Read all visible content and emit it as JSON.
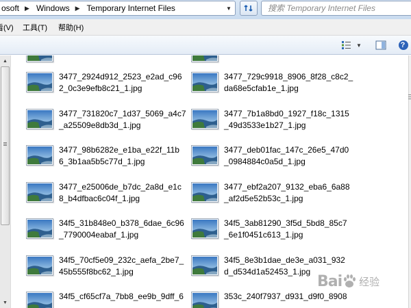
{
  "address": {
    "crumbs": [
      "osoft",
      "Windows",
      "Temporary Internet Files"
    ],
    "separator": "▶",
    "dropdown_icon": "chevron-down-icon"
  },
  "search": {
    "placeholder": "搜索 Temporary Internet Files",
    "icon": "search-icon"
  },
  "refresh": {
    "icon": "refresh-icon"
  },
  "menu": [
    {
      "label": "看(V)"
    },
    {
      "label": "工具(T)"
    },
    {
      "label": "帮助(H)"
    }
  ],
  "toolbar": {
    "view_icon": "view-options-icon",
    "view_dropdown_icon": "chevron-down-icon",
    "preview_pane_icon": "preview-pane-icon",
    "help_icon": "help-icon",
    "help_label": "?"
  },
  "files": [
    {
      "line1": "3477_2924d912_2523_e2ad_c96",
      "line2": "2_0c3e9efb8c21_1.jpg"
    },
    {
      "line1": "3477_729c9918_8906_8f28_c8c2_",
      "line2": "da68e5cfab1e_1.jpg"
    },
    {
      "line1": "3477_731820c7_1d37_5069_a4c7",
      "line2": "_a25509e8db3d_1.jpg"
    },
    {
      "line1": "3477_7b1a8bd0_1927_f18c_1315",
      "line2": "_49d3533e1b27_1.jpg"
    },
    {
      "line1": "3477_98b6282e_e1ba_e22f_11b",
      "line2": "6_3b1aa5b5c77d_1.jpg"
    },
    {
      "line1": "3477_deb01fac_147c_26e5_47d0",
      "line2": "_0984884c0a5d_1.jpg"
    },
    {
      "line1": "3477_e25006de_b7dc_2a8d_e1c",
      "line2": "8_b4dfbac6c04f_1.jpg"
    },
    {
      "line1": "3477_ebf2a207_9132_eba6_6a88",
      "line2": "_af2d5e52b53c_1.jpg"
    },
    {
      "line1": "34f5_31b848e0_b378_6dae_6c96",
      "line2": "_7790004eabaf_1.jpg"
    },
    {
      "line1": "34f5_3ab81290_3f5d_5bd8_85c7",
      "line2": "_6e1f0451c613_1.jpg"
    },
    {
      "line1": "34f5_70cf5e09_232c_aefa_2be7_",
      "line2": "45b555f8bc62_1.jpg"
    },
    {
      "line1": "34f5_8e3b1dae_de3e_a031_932",
      "line2": "d_d534d1a52453_1.jpg"
    },
    {
      "line1": "34f5_cf65cf7a_7bb8_ee9b_9dff_6",
      "line2": ""
    },
    {
      "line1": "353c_240f7937_d931_d9f0_8908",
      "line2": ""
    }
  ],
  "watermark": {
    "text": "Bai",
    "suffix": "经验"
  },
  "colors": {
    "sky_top": "#3a78c2",
    "sky_bottom": "#bfe0f2",
    "sea": "#2e5f8e",
    "land": "#3f7a3c"
  }
}
